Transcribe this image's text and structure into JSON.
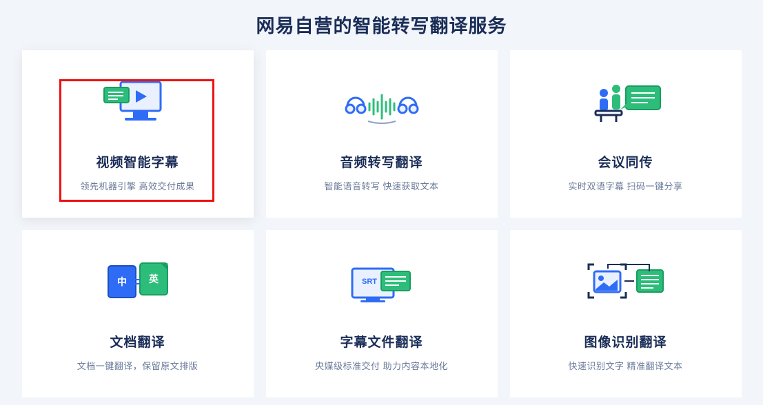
{
  "page": {
    "title": "网易自营的智能转写翻译服务"
  },
  "colors": {
    "accent_blue": "#2f6cf6",
    "accent_green": "#2dbd7a",
    "text_dark": "#1a2d57",
    "text_muted": "#6a7a99",
    "highlight_red": "#ef1010"
  },
  "cards": [
    {
      "title": "视频智能字幕",
      "desc": "领先机器引擎 高效交付成果",
      "icon": "video-subtitle",
      "highlighted": true
    },
    {
      "title": "音频转写翻译",
      "desc": "智能语音转写 快速获取文本",
      "icon": "audio-transcribe",
      "highlighted": false
    },
    {
      "title": "会议同传",
      "desc": "实时双语字幕 扫码一键分享",
      "icon": "meeting-interpret",
      "highlighted": false
    },
    {
      "title": "文档翻译",
      "desc": "文档一键翻译，保留原文排版",
      "icon": "doc-translate",
      "highlighted": false
    },
    {
      "title": "字幕文件翻译",
      "desc": "央媒级标准交付 助力内容本地化",
      "icon": "srt-translate",
      "highlighted": false
    },
    {
      "title": "图像识别翻译",
      "desc": "快速识别文字 精准翻译文本",
      "icon": "image-ocr",
      "highlighted": false
    }
  ]
}
